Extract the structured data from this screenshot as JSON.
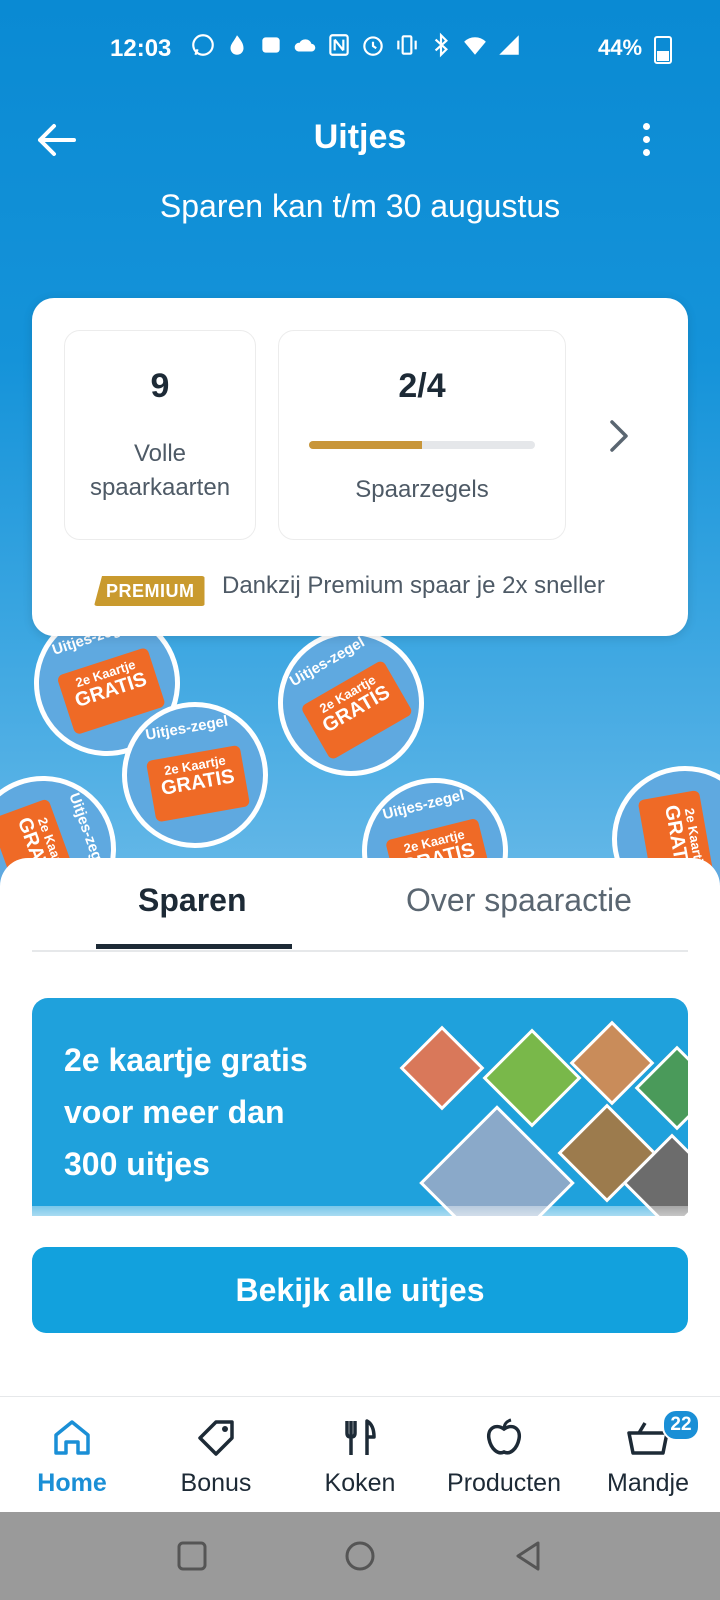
{
  "status_bar": {
    "time": "12:03",
    "battery": "44%"
  },
  "header": {
    "title": "Uitjes",
    "subtitle": "Sparen kan t/m 30 augustus"
  },
  "summary": {
    "full_cards_count": "9",
    "full_cards_label_line1": "Volle",
    "full_cards_label_line2": "spaarkaarten",
    "stamps_progress": "2/4",
    "stamps_progress_fraction": 0.5,
    "stamps_label": "Spaarzegels",
    "premium_badge": "PREMIUM",
    "premium_text": "Dankzij Premium spaar je 2x sneller"
  },
  "stamp_art": {
    "ring_text": "Uitjes-zegel",
    "ticket_line1": "2e Kaartje",
    "ticket_line2": "GRATIS"
  },
  "tabs": [
    {
      "label": "Sparen",
      "active": true
    },
    {
      "label": "Over spaaractie",
      "active": false
    }
  ],
  "banner": {
    "line1": "2e kaartje gratis",
    "line2": "voor meer dan",
    "line3": "300 uitjes"
  },
  "cta": {
    "label": "Bekijk alle uitjes"
  },
  "bottom_nav": [
    {
      "label": "Home",
      "icon": "home-icon",
      "active": true
    },
    {
      "label": "Bonus",
      "icon": "tag-icon",
      "active": false
    },
    {
      "label": "Koken",
      "icon": "fork-knife-icon",
      "active": false
    },
    {
      "label": "Producten",
      "icon": "apple-icon",
      "active": false
    },
    {
      "label": "Mandje",
      "icon": "basket-icon",
      "active": false,
      "badge": "22"
    }
  ],
  "colors": {
    "brand_blue": "#1a8fd6",
    "premium_gold": "#c99a2e",
    "stamp_orange": "#ef6a26"
  }
}
